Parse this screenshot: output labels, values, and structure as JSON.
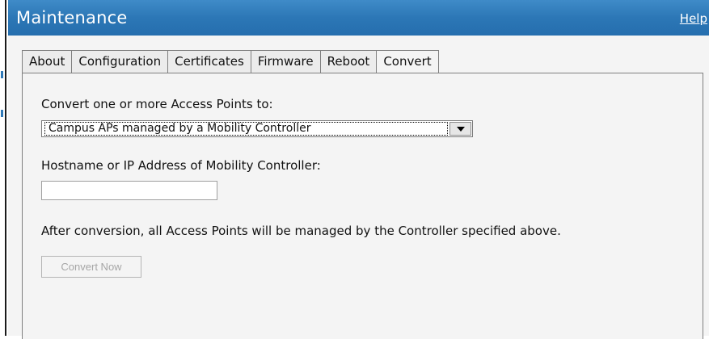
{
  "window": {
    "title": "Maintenance",
    "help_label": "Help"
  },
  "tabs": [
    {
      "label": "About",
      "active": false
    },
    {
      "label": "Configuration",
      "active": false
    },
    {
      "label": "Certificates",
      "active": false
    },
    {
      "label": "Firmware",
      "active": false
    },
    {
      "label": "Reboot",
      "active": false
    },
    {
      "label": "Convert",
      "active": true
    }
  ],
  "convert": {
    "convert_to_label": "Convert one or more Access Points to:",
    "convert_to_selected": "Campus APs managed by a Mobility Controller",
    "hostname_label": "Hostname or IP Address of Mobility Controller:",
    "hostname_value": "",
    "note": "After conversion, all Access Points will be managed by the Controller specified above.",
    "convert_button_label": "Convert Now",
    "convert_button_enabled": false
  },
  "colors": {
    "titlebar": "#2c77b6",
    "panel_background": "#f4f4f4",
    "disabled_text": "#a6a6a6"
  },
  "icons": {
    "dropdown": "chevron-down-icon"
  }
}
